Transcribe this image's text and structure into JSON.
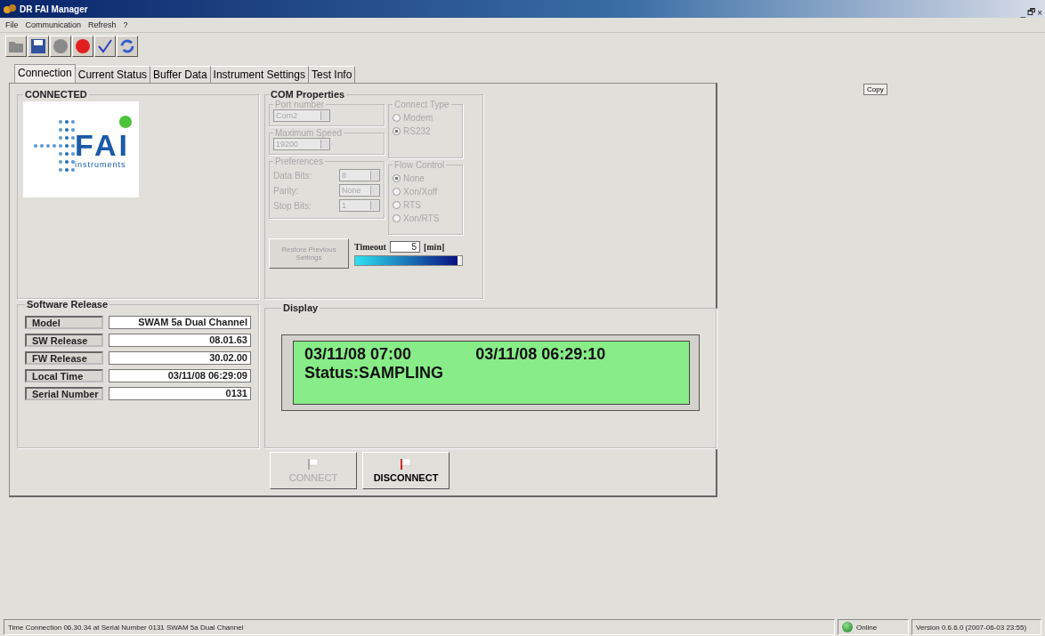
{
  "window": {
    "title": "DR FAI Manager",
    "controls": [
      "_",
      "🗗",
      "×"
    ]
  },
  "menu": [
    "File",
    "Communication",
    "Refresh",
    "?"
  ],
  "toolbar": [
    {
      "kind": "folder",
      "disabled": true
    },
    {
      "kind": "save",
      "disabled": false
    },
    {
      "kind": "circle",
      "disabled": true
    },
    {
      "kind": "record",
      "disabled": false
    },
    {
      "kind": "check",
      "disabled": false
    },
    {
      "kind": "refresh",
      "disabled": false
    }
  ],
  "tabs": [
    {
      "label": "Connection",
      "selected": true
    },
    {
      "label": "Current Status",
      "selected": false
    },
    {
      "label": "Buffer Data",
      "selected": false
    },
    {
      "label": "Instrument Settings",
      "selected": false
    },
    {
      "label": "Test Info",
      "selected": false
    }
  ],
  "connection": {
    "title": "CONNECTED",
    "connected": true,
    "logo": {
      "name": "FAI",
      "tagline": "instruments"
    }
  },
  "com_properties": {
    "title": "COM Properties",
    "disabled": true,
    "port_number": {
      "label": "Port number",
      "value": "Com2"
    },
    "maximum_speed": {
      "label": "Maximum Speed",
      "value": "19200"
    },
    "connect_type": {
      "label": "Connect Type",
      "options": [
        {
          "label": "Modem",
          "selected": false
        },
        {
          "label": "RS232",
          "selected": true
        }
      ]
    },
    "preferences": {
      "label": "Preferences",
      "fields": [
        {
          "label": "Data Bits:",
          "value": "8"
        },
        {
          "label": "Parity:",
          "value": "None"
        },
        {
          "label": "Stop Bits:",
          "value": "1"
        }
      ]
    },
    "flow_control": {
      "label": "Flow Control",
      "options": [
        {
          "label": "None",
          "selected": true
        },
        {
          "label": "Xon/Xoff",
          "selected": false
        },
        {
          "label": "RTS",
          "selected": false
        },
        {
          "label": "Xon/RTS",
          "selected": false
        }
      ]
    },
    "restore_button": "Restore Previous Settings",
    "timeout": {
      "label": "Timeout",
      "value": "5",
      "unit": "[min]"
    },
    "progress": {
      "level": 0.96
    }
  },
  "software_release": {
    "title": "Software Release",
    "rows": [
      {
        "label": "Model",
        "value": "SWAM 5a Dual Channel"
      },
      {
        "label": "SW Release",
        "value": "08.01.63"
      },
      {
        "label": "FW Release",
        "value": "30.02.00"
      },
      {
        "label": "Local Time",
        "value": "03/11/08 06:29:09"
      },
      {
        "label": "Serial Number",
        "value": "0131"
      }
    ]
  },
  "display": {
    "title": "Display",
    "line_1": [
      "03/11/08 07:00",
      "03/11/08 06:29:10"
    ],
    "line_2": "Status:SAMPLING"
  },
  "buttons": [
    {
      "label": "CONNECT",
      "disabled": true
    },
    {
      "label": "DISCONNECT",
      "disabled": false
    }
  ],
  "copy_button": "Copy",
  "status_bar": {
    "message": "Time Connection 06.30.34 at  Serial Number 0131 SWAM 5a Dual Channel",
    "online": true,
    "online_label": "Online",
    "version": "Version 0.6.6.0 (2007-06-03 23:55)"
  }
}
